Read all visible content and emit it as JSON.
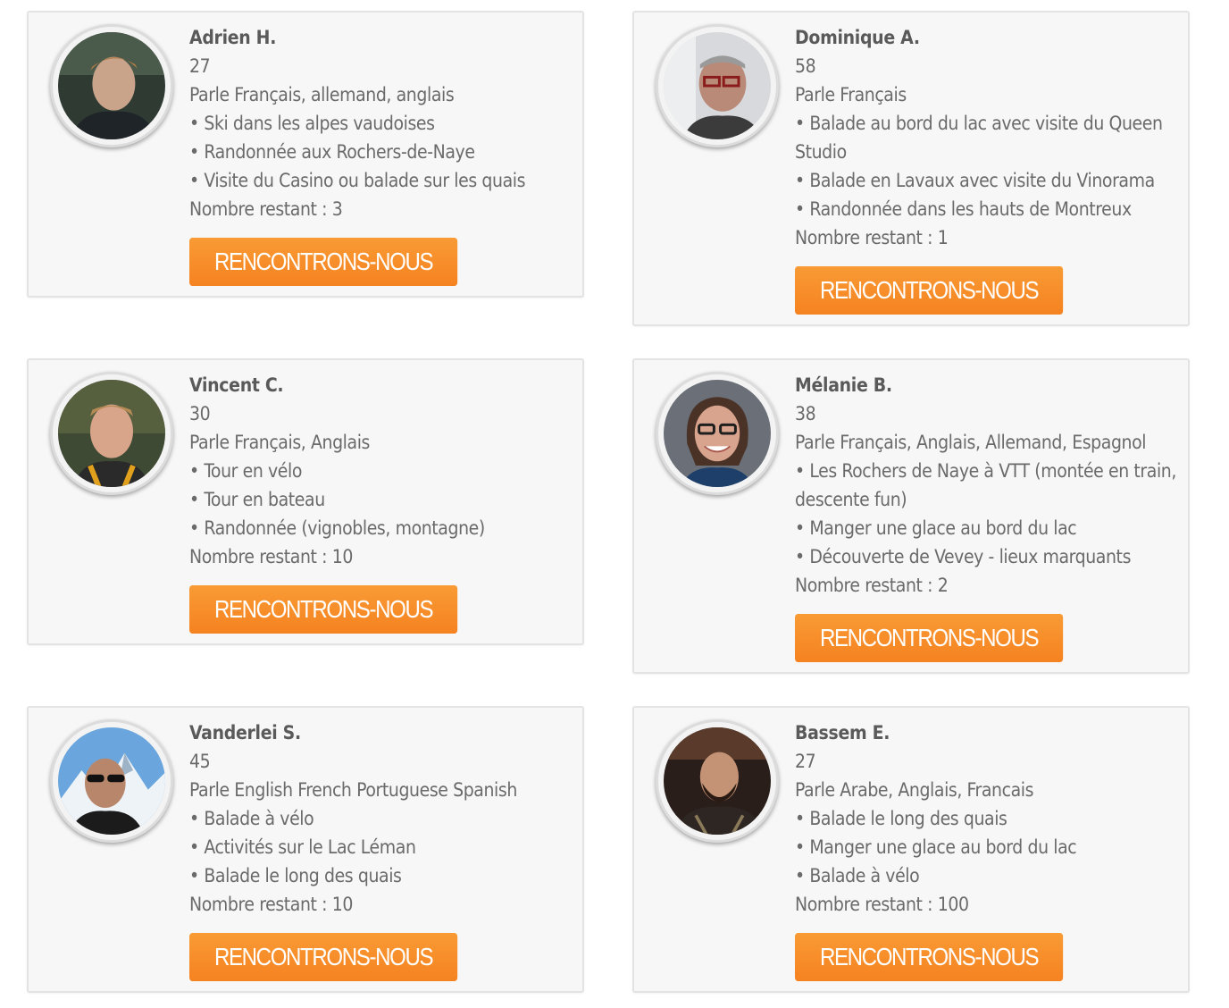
{
  "button_label": "RENCONTRONS-NOUS",
  "accent_color": "#f58220",
  "profiles": [
    {
      "name": "Adrien H.",
      "age": "27",
      "languages": "Parle Français, allemand, anglais",
      "activities": [
        "• Ski dans les alpes vaudoises",
        "• Randonnée aux Rochers-de-Naye",
        "• Visite du Casino ou balade sur les quais"
      ],
      "remaining": "Nombre restant : 3"
    },
    {
      "name": "Dominique A.",
      "age": "58",
      "languages": "Parle Français",
      "activities": [
        "• Balade au bord du lac avec visite du Queen Studio",
        "• Balade en Lavaux avec visite du Vinorama",
        "• Randonnée dans les hauts de Montreux"
      ],
      "remaining": "Nombre restant : 1"
    },
    {
      "name": "Vincent C.",
      "age": "30",
      "languages": "Parle Français, Anglais",
      "activities": [
        "• Tour en vélo",
        "• Tour en bateau",
        "• Randonnée (vignobles, montagne)"
      ],
      "remaining": "Nombre restant : 10"
    },
    {
      "name": "Mélanie B.",
      "age": "38",
      "languages": "Parle Français, Anglais, Allemand, Espagnol",
      "activities": [
        "• Les Rochers de Naye à VTT (montée en train, descente fun)",
        "• Manger une glace au bord du lac",
        "• Découverte de Vevey - lieux marquants"
      ],
      "remaining": "Nombre restant : 2"
    },
    {
      "name": "Vanderlei S.",
      "age": "45",
      "languages": "Parle English French Portuguese Spanish",
      "activities": [
        "• Balade à vélo",
        "• Activités sur le Lac Léman",
        "• Balade le long des quais"
      ],
      "remaining": "Nombre restant : 10"
    },
    {
      "name": "Bassem E.",
      "age": "27",
      "languages": "Parle Arabe, Anglais, Francais",
      "activities": [
        "• Balade le long des quais",
        "• Manger une glace au bord du lac",
        "• Balade à vélo"
      ],
      "remaining": "Nombre restant : 100"
    }
  ]
}
